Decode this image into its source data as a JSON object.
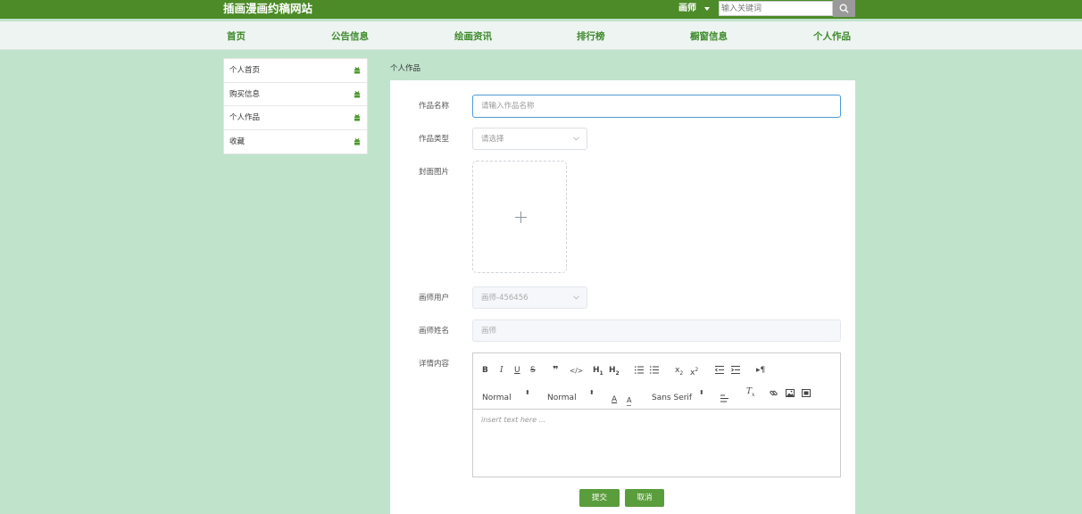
{
  "header": {
    "site_title": "插画漫画约稿网站",
    "role": "画师",
    "search": {
      "placeholder": "输入关键词",
      "value": ""
    }
  },
  "nav": {
    "items": [
      {
        "label": "首页"
      },
      {
        "label": "公告信息"
      },
      {
        "label": "绘画资讯"
      },
      {
        "label": "排行榜"
      },
      {
        "label": "橱窗信息"
      },
      {
        "label": "个人作品"
      }
    ]
  },
  "sidebar": {
    "items": [
      {
        "label": "个人首页"
      },
      {
        "label": "购买信息"
      },
      {
        "label": "个人作品"
      },
      {
        "label": "收藏"
      }
    ]
  },
  "breadcrumb": "个人作品",
  "form": {
    "work_name": {
      "label": "作品名称",
      "placeholder": "请输入作品名称"
    },
    "work_type": {
      "label": "作品类型",
      "placeholder": "请选择"
    },
    "cover": {
      "label": "封面图片"
    },
    "artist_user": {
      "label": "画师用户",
      "value": "画师-456456"
    },
    "artist_name": {
      "label": "画师姓名",
      "value": "画师"
    },
    "details": {
      "label": "详情内容",
      "header_select": "Normal",
      "size_select": "Normal",
      "font_select": "Sans Serif",
      "placeholder": "insert text here ..."
    },
    "submit_label": "提交",
    "cancel_label": "取消"
  },
  "colors": {
    "page_bg": "#c0e3cc",
    "topbar": "#4c8b28",
    "nav_text": "#3d8a2a",
    "button": "#5a9d3c"
  }
}
